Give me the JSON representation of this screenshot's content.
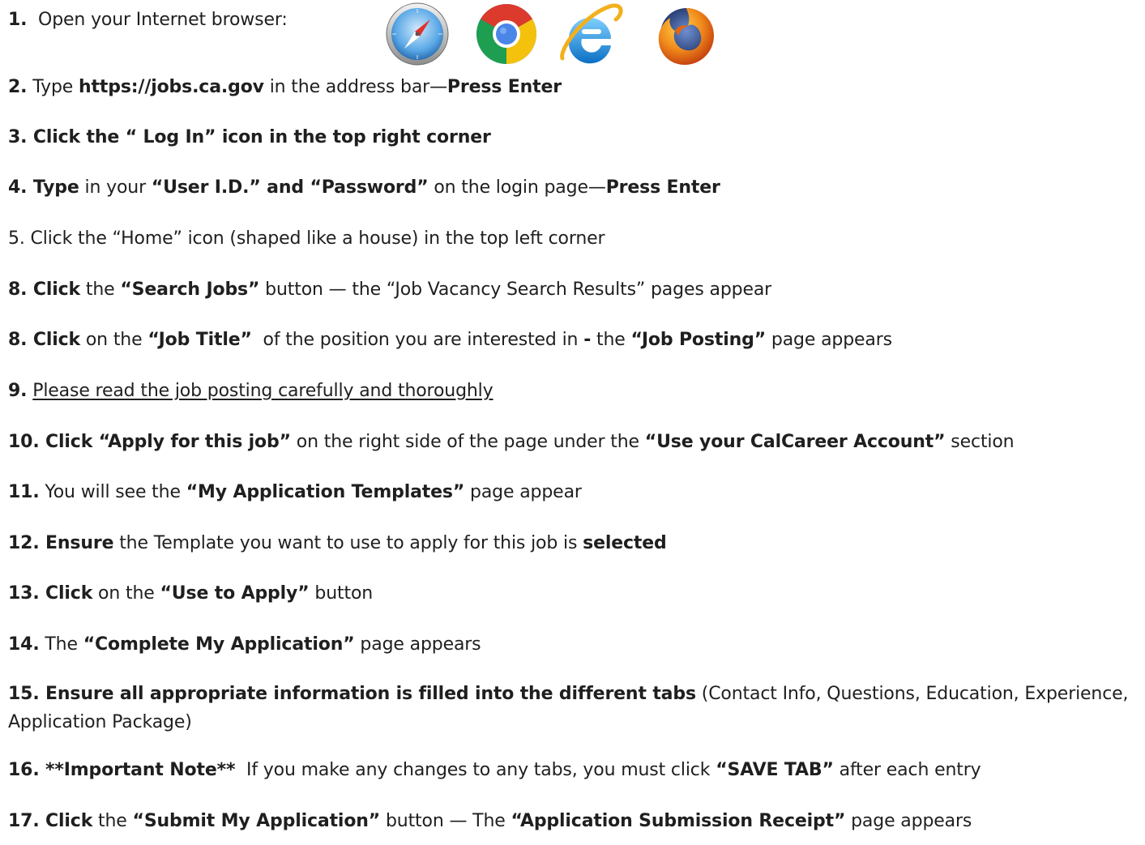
{
  "steps": [
    {
      "id": "s1",
      "parts": [
        {
          "t": "1.",
          "b": true
        },
        {
          "t": "  Open your Internet browser:"
        }
      ]
    },
    {
      "id": "s2",
      "parts": [
        {
          "t": "2.",
          "b": true
        },
        {
          "t": " Type "
        },
        {
          "t": "https://jobs.ca.gov",
          "b": true
        },
        {
          "t": " in the address bar—"
        },
        {
          "t": "Press Enter",
          "b": true
        }
      ]
    },
    {
      "id": "s3",
      "parts": [
        {
          "t": "3. Click the “ Log In” icon in the top right corner",
          "b": true
        }
      ]
    },
    {
      "id": "s4",
      "parts": [
        {
          "t": "4. Type",
          "b": true
        },
        {
          "t": " in your "
        },
        {
          "t": "“User I.D.” and “Password”",
          "b": true
        },
        {
          "t": " on the login page—"
        },
        {
          "t": "Press Enter",
          "b": true
        }
      ]
    },
    {
      "id": "s5",
      "parts": [
        {
          "t": "5. Click the “Home” icon (shaped like a house) in the top left corner"
        }
      ]
    },
    {
      "id": "s6",
      "parts": [
        {
          "t": "8. Click",
          "b": true
        },
        {
          "t": " the "
        },
        {
          "t": "“Search Jobs”",
          "b": true
        },
        {
          "t": " button — the “Job Vacancy Search Results” pages appear"
        }
      ]
    },
    {
      "id": "s7",
      "parts": [
        {
          "t": "8. Click",
          "b": true
        },
        {
          "t": " on the "
        },
        {
          "t": "“Job Title”",
          "b": true
        },
        {
          "t": "  of the position you are interested in "
        },
        {
          "t": "-",
          "b": true
        },
        {
          "t": " the "
        },
        {
          "t": "“Job Posting”",
          "b": true
        },
        {
          "t": " page appears"
        }
      ]
    },
    {
      "id": "s8",
      "parts": [
        {
          "t": "9.",
          "b": true
        },
        {
          "t": " "
        },
        {
          "t": "Please read the job posting carefully and thoroughly",
          "u": true
        }
      ]
    },
    {
      "id": "s9",
      "parts": [
        {
          "t": "10. Click “Apply for this job”",
          "b": true
        },
        {
          "t": " on the right side of the page under the "
        },
        {
          "t": "“Use your CalCareer Account”",
          "b": true
        },
        {
          "t": " section"
        }
      ]
    },
    {
      "id": "s10",
      "parts": [
        {
          "t": "11.",
          "b": true
        },
        {
          "t": " You will see the "
        },
        {
          "t": "“My Application Templates”",
          "b": true
        },
        {
          "t": " page appear"
        }
      ]
    },
    {
      "id": "s11",
      "parts": [
        {
          "t": "12. Ensure",
          "b": true
        },
        {
          "t": " the Template you want to use to apply for this job is "
        },
        {
          "t": "selected",
          "b": true
        }
      ]
    },
    {
      "id": "s12",
      "parts": [
        {
          "t": "13. Click",
          "b": true
        },
        {
          "t": " on the "
        },
        {
          "t": "“Use to Apply”",
          "b": true
        },
        {
          "t": " button"
        }
      ]
    },
    {
      "id": "s13",
      "parts": [
        {
          "t": "14.",
          "b": true
        },
        {
          "t": " The "
        },
        {
          "t": "“Complete My Application”",
          "b": true
        },
        {
          "t": " page appears"
        }
      ]
    },
    {
      "id": "s14",
      "parts": [
        {
          "t": "15. Ensure all appropriate information is filled into the different tabs",
          "b": true
        },
        {
          "t": " (Contact Info, Questions, Education, Experience, Application Package)"
        }
      ]
    },
    {
      "id": "s15",
      "parts": [
        {
          "t": "16. **Important Note**",
          "b": true
        },
        {
          "t": "  If you make any changes to any tabs, you must click "
        },
        {
          "t": "“SAVE TAB”",
          "b": true
        },
        {
          "t": " after each entry"
        }
      ]
    },
    {
      "id": "s16",
      "parts": [
        {
          "t": "17. Click",
          "b": true
        },
        {
          "t": " the "
        },
        {
          "t": "“Submit My Application”",
          "b": true
        },
        {
          "t": " button — The "
        },
        {
          "t": "“Application Submission Receipt”",
          "b": true
        },
        {
          "t": " page appears"
        }
      ]
    }
  ],
  "browser_icons": [
    "safari-icon",
    "chrome-icon",
    "internet-explorer-icon",
    "firefox-icon"
  ],
  "colors": {
    "text": "#1f1f1f",
    "safari_blue": "#3a8fd6",
    "chrome_red": "#db3a2c",
    "chrome_yellow": "#f4c20d",
    "chrome_green": "#1e9e50",
    "chrome_blue": "#4a86e8",
    "ie_blue": "#1c8fd8",
    "ie_ring": "#f2b01e",
    "firefox_orange": "#e6650f",
    "firefox_globe": "#24417a"
  }
}
